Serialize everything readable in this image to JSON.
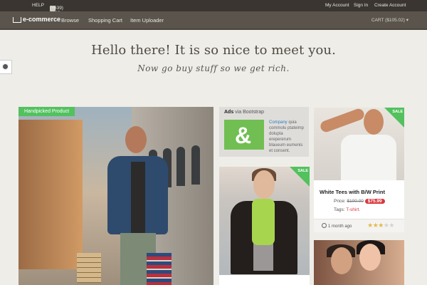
{
  "topbar": {
    "help_label": "HELP",
    "phone": "(+639) 3665-7624",
    "links": [
      "My Account",
      "Sign In",
      "Create Account"
    ]
  },
  "navbar": {
    "brand": "e-commerce",
    "items": [
      "Browse",
      "Shopping Cart",
      "Item Uploader"
    ],
    "cart_label": "CART ($105.02) ▾"
  },
  "hero": {
    "title": "Hello there! It is so nice to meet you.",
    "subtitle": "Now go buy stuff so we get rich."
  },
  "featured": {
    "ribbon": "Handpicked Product"
  },
  "ads": {
    "title_bold": "Ads",
    "title_rest": " via Bootstrap",
    "text_link": "Company",
    "text_body": " quia commolu ptateimp dolupta erepererum blaueum eumenis et consent."
  },
  "sale": {
    "label": "SALE"
  },
  "product": {
    "title": "White Tees with B/W Print",
    "price_label": "Price: ",
    "old_price": "$100.00",
    "new_price": "$75.99",
    "tags_label": "Tags: ",
    "tag": "T-shirt.",
    "time": "1 month ago",
    "rating": 3,
    "rating_max": 5,
    "sale_label": "SALE"
  },
  "colors": {
    "accent_green": "#52c15e",
    "price_red": "#d8383d",
    "topbar": "#3a3530",
    "navbar": "#5a544c"
  }
}
